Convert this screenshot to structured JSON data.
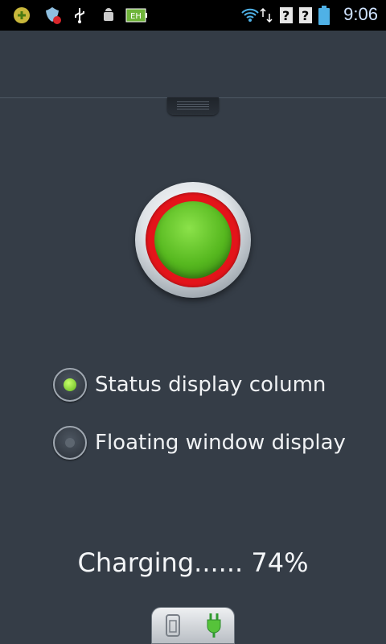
{
  "status_bar": {
    "time": "9:06",
    "icons": [
      "game-icon",
      "shield-alert-icon",
      "usb-icon",
      "android-debug-icon",
      "battery-app-icon",
      "wifi-icon",
      "data-arrows-icon",
      "no-sim-icon",
      "no-sim-icon",
      "battery-icon"
    ]
  },
  "main_button": {
    "state": "green",
    "ring_color": "#e3141a",
    "center_color": "#56b81f"
  },
  "options": [
    {
      "label": "Status display column",
      "checked": true
    },
    {
      "label": "Floating window display",
      "checked": false
    }
  ],
  "status": {
    "charging_text": "Charging...... 74%"
  },
  "bottom_toggle": {
    "left_icon": "phone-icon",
    "right_icon": "plug-icon"
  },
  "colors": {
    "background": "#353d47",
    "accent_green": "#63b51d",
    "accent_red": "#e3141a"
  }
}
